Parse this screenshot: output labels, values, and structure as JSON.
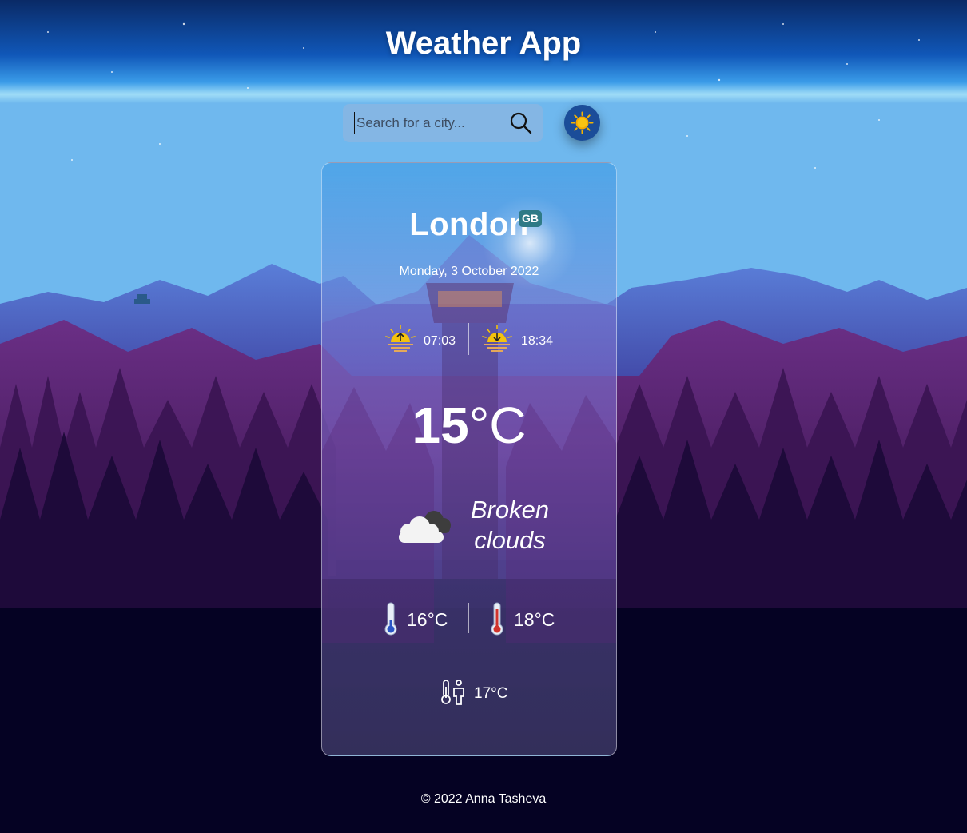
{
  "app": {
    "title": "Weather App"
  },
  "search": {
    "placeholder": "Search for a city...",
    "value": "",
    "button_icon": "search-icon"
  },
  "theme_toggle": {
    "icon": "sun-icon",
    "color": "#f4b400"
  },
  "weather": {
    "city": "London",
    "country_code": "GB",
    "date": "Monday, 3 October 2022",
    "sunrise": "07:03",
    "sunset": "18:34",
    "temperature": "15",
    "temperature_unit": "°C",
    "description_line1": "Broken",
    "description_line2": "clouds",
    "condition_icon": "broken-clouds-icon",
    "temp_min": "16°C",
    "temp_max": "18°C",
    "feels_like": "17°C"
  },
  "footer": {
    "text": "© 2022 Anna Tasheva"
  },
  "colors": {
    "badge": "#2e7a86",
    "sun": "#f4c20d",
    "min_thermo": "#2a56c6",
    "max_thermo": "#d0342c"
  }
}
